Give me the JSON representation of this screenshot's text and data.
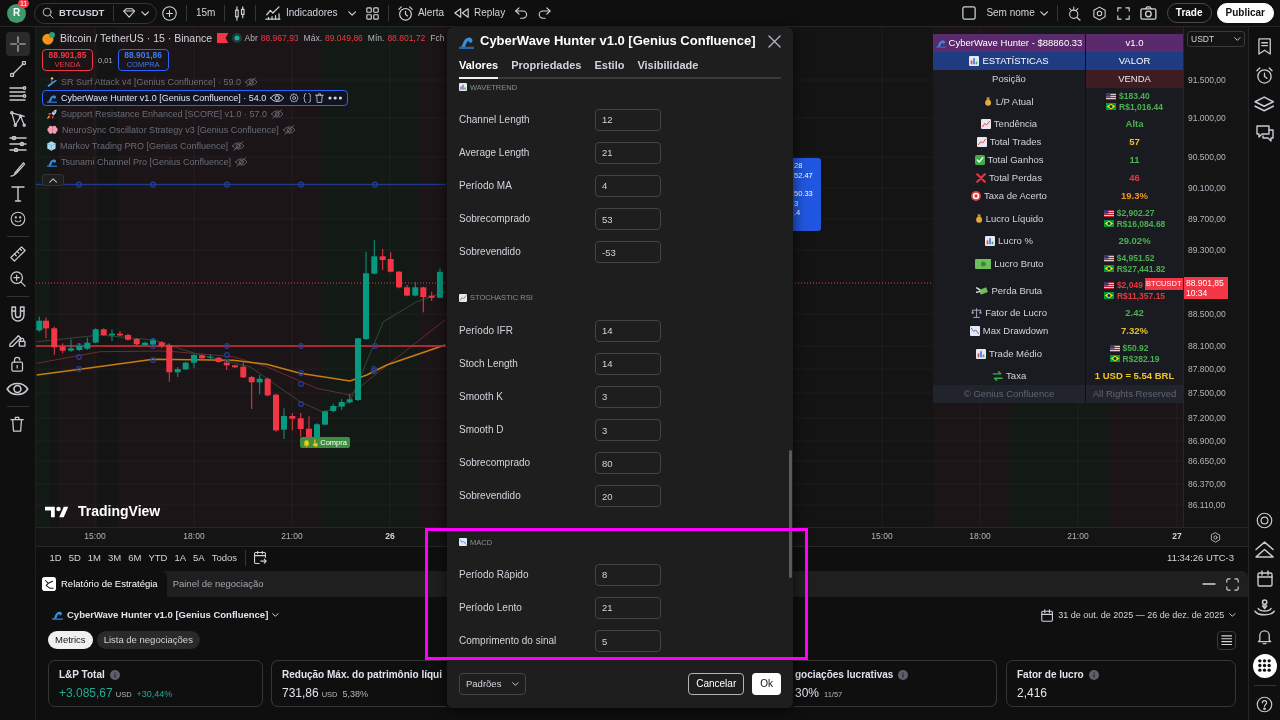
{
  "top_bar": {
    "avatar": {
      "letter": "R",
      "badge": "11"
    },
    "symbol": "BTCUSDT",
    "interval": "15m",
    "indicators_label": "Indicadores",
    "alert_label": "Alerta",
    "replay_label": "Replay",
    "layout_name": "Sem nome",
    "trade_label": "Trade",
    "publish_label": "Publicar"
  },
  "drawing_tools": [
    {
      "selected": true
    },
    {
      "selected": false
    },
    {
      "selected": false
    },
    {
      "selected": false
    },
    {
      "selected": false
    },
    {
      "selected": false
    },
    {
      "selected": false
    },
    {
      "selected": false
    },
    {
      "selected": false
    },
    {
      "selected": false
    },
    {
      "selected": false
    },
    {
      "selected": false
    },
    {
      "selected": false
    },
    {
      "selected": false
    },
    {
      "selected": false
    }
  ],
  "chart": {
    "symbol_title": "Bitcoin / TetherUS · 15 · Binance",
    "ohlc": [
      {
        "label": "Abr",
        "value": "88.967,93"
      },
      {
        "label": "Máx.",
        "value": "89.049,86"
      },
      {
        "label": "Mín.",
        "value": "88.801,72"
      },
      {
        "label": "Fch"
      }
    ],
    "sell": {
      "price": "88.901,85",
      "label": "VENDA"
    },
    "spread": "0,01",
    "buy": {
      "price": "88.901,86",
      "label": "COMPRA"
    },
    "indicators": [
      {
        "name": "SR Surf Attack v4 [Genius Confluence] · 59.0",
        "visible": false,
        "selected": false
      },
      {
        "name": "CyberWave Hunter v1.0 [Genius Confluence] · 54.0",
        "visible": true,
        "selected": true
      },
      {
        "name": "Support Resistance Enhanced [SCORE] v1.0 · 57.0",
        "visible": false,
        "selected": false
      },
      {
        "name": "NeuroSync Oscillator Strategy v3 [Genius Confluence]",
        "visible": false,
        "selected": false
      },
      {
        "name": "Markov Trading PRO [Genius Confluence]",
        "visible": false,
        "selected": false
      },
      {
        "name": "Tsunami Channel Pro [Genius Confluence]",
        "visible": false,
        "selected": false
      }
    ],
    "trade_label": [
      "28",
      "52.47",
      "50.33",
      "3",
      ".4"
    ],
    "signal_tag": "Compra",
    "logo_text": "TradingView",
    "currency": "USDT",
    "price_axis": [
      "91.500,00",
      "91.000,00",
      "90.500,00",
      "90.100,00",
      "89.700,00",
      "89.300,00",
      "88.500,00",
      "88.100,00",
      "87.800,00",
      "87.500,00",
      "87.200,00",
      "86.900,00",
      "86.650,00",
      "86.370,00",
      "86.110,00"
    ],
    "last_price": {
      "symbol": "BTCUSDT",
      "price": "88.901,85",
      "countdown": "10:34"
    },
    "time_axis": [
      {
        "label": "15:00",
        "kind": "time"
      },
      {
        "label": "18:00",
        "kind": "time"
      },
      {
        "label": "21:00",
        "kind": "time"
      },
      {
        "label": "26",
        "kind": "day"
      },
      {
        "label": "15:00",
        "kind": "time"
      },
      {
        "label": "18:00",
        "kind": "time"
      },
      {
        "label": "21:00",
        "kind": "time"
      },
      {
        "label": "27",
        "kind": "day"
      }
    ]
  },
  "stats_table": {
    "title": "CyberWave Hunter - $88860.33",
    "version": "v1.0",
    "headers": [
      "ESTATÍSTICAS",
      "VALOR"
    ],
    "rows": [
      {
        "kind": "position",
        "label": "Posição",
        "value": "VENDA",
        "color": "#3d1c22"
      },
      {
        "kind": "money",
        "label": "L/P Atual",
        "usd": "$183.40",
        "brl": "R$1,016.44",
        "color": "#4caf50"
      },
      {
        "kind": "text",
        "label": "Tendência",
        "value": "Alta",
        "color": "#4caf50"
      },
      {
        "kind": "text",
        "label": "Total Trades",
        "value": "57",
        "color": "#e8c02e"
      },
      {
        "kind": "text",
        "label": "Total Ganhos",
        "value": "11",
        "color": "#4caf50"
      },
      {
        "kind": "text",
        "label": "Total Perdas",
        "value": "46",
        "color": "#e5393f"
      },
      {
        "kind": "text",
        "label": "Taxa de Acerto",
        "value": "19.3%",
        "color": "#f09a1a"
      },
      {
        "kind": "money",
        "label": "Lucro Líquido",
        "usd": "$2,902.27",
        "brl": "R$16,084.68",
        "color": "#4caf50"
      },
      {
        "kind": "text",
        "label": "Lucro %",
        "value": "29.02%",
        "color": "#4caf50"
      },
      {
        "kind": "money",
        "label": "Lucro Bruto",
        "usd": "$4,951.52",
        "brl": "R$27,441.82",
        "color": "#4caf50"
      },
      {
        "kind": "money",
        "label": "Perda Bruta",
        "usd": "$2,049",
        "brl": "R$11,357.15",
        "color": "#e5393f"
      },
      {
        "kind": "text",
        "label": "Fator de Lucro",
        "value": "2.42",
        "color": "#4caf50"
      },
      {
        "kind": "text",
        "label": "Max Drawdown",
        "value": "7.32%",
        "color": "#e8c02e"
      },
      {
        "kind": "money",
        "label": "Trade Médio",
        "usd": "$50.92",
        "brl": "R$282.19",
        "color": "#4caf50"
      },
      {
        "kind": "text",
        "label": "Taxa",
        "value": "1 USD = 5.54 BRL",
        "color": "#f5c518"
      }
    ],
    "footer": [
      "© Genius Confluence",
      "All Rights Reserved"
    ]
  },
  "range_bar": {
    "ranges": [
      "1D",
      "5D",
      "1M",
      "3M",
      "6M",
      "YTD",
      "1A",
      "5A",
      "Todos"
    ],
    "clock": "11:34:26 UTC-3"
  },
  "bottom_panel": {
    "tabs": [
      {
        "label": "Relatório de Estratégia",
        "selected": true
      },
      {
        "label": "Painel de negociação",
        "selected": false
      }
    ],
    "strategy": "CyberWave Hunter v1.0 [Genius Confluence]",
    "date_range": "31 de out. de 2025 — 26 de dez. de 2025",
    "views": [
      {
        "label": "Metrics",
        "selected": true
      },
      {
        "label": "Lista de negociações",
        "selected": false
      }
    ],
    "metrics": [
      {
        "title": "L&P Total",
        "info": true,
        "value": "+3.085,67",
        "unit": "USD",
        "change": "+30,44%",
        "positive": true
      },
      {
        "title": "Redução Máx. do patrimônio líqui",
        "info": false,
        "value": "731,86",
        "unit": "USD",
        "change": "5,38%",
        "positive": false
      },
      {
        "title": "gociações lucrativas",
        "info": true,
        "value": "30%",
        "change": "11/57",
        "positive": false
      },
      {
        "title": "Fator de lucro",
        "info": true,
        "value": "2,416",
        "positive": false
      }
    ]
  },
  "side_buttons": [
    {
      "selected": false
    },
    {
      "selected": false
    },
    {
      "selected": false
    },
    {
      "selected": false
    },
    {
      "selected": false
    },
    {
      "selected": false
    },
    {
      "selected": false
    },
    {
      "selected": false
    },
    {
      "selected": false
    },
    {
      "selected": true
    },
    {
      "selected": false
    }
  ],
  "dialog": {
    "title": "CyberWave Hunter v1.0 [Genius Confluence]",
    "tabs": [
      {
        "label": "Valores",
        "selected": true
      },
      {
        "label": "Propriedades",
        "selected": false
      },
      {
        "label": "Estilo",
        "selected": false
      },
      {
        "label": "Visibilidade",
        "selected": false
      }
    ],
    "sections": [
      {
        "title": "WAVETREND",
        "fields": [
          {
            "label": "Channel Length",
            "value": "12"
          },
          {
            "label": "Average Length",
            "value": "21"
          },
          {
            "label": "Período MA",
            "value": "4"
          },
          {
            "label": "Sobrecomprado",
            "value": "53"
          },
          {
            "label": "Sobrevendido",
            "value": "-53"
          }
        ]
      },
      {
        "title": "STOCHASTIC RSI",
        "fields": [
          {
            "label": "Período IFR",
            "value": "14"
          },
          {
            "label": "Stoch Length",
            "value": "14"
          },
          {
            "label": "Smooth K",
            "value": "3"
          },
          {
            "label": "Smooth D",
            "value": "3"
          },
          {
            "label": "Sobrecomprado",
            "value": "80"
          },
          {
            "label": "Sobrevendido",
            "value": "20"
          }
        ]
      },
      {
        "title": "MACD",
        "fields": [
          {
            "label": "Período Rápido",
            "value": "8"
          },
          {
            "label": "Período Lento",
            "value": "21"
          },
          {
            "label": "Comprimento do sinal",
            "value": "5"
          }
        ]
      }
    ],
    "defaults_label": "Padrões",
    "cancel_label": "Cancelar",
    "ok_label": "Ok"
  }
}
